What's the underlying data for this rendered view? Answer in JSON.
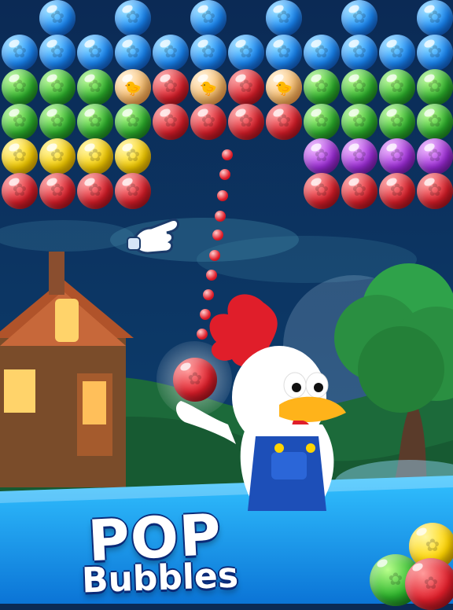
{
  "title": {
    "line1": "POP",
    "line2": "Bubbles"
  },
  "colors": {
    "sky_top": "#0b2a55",
    "sky_mid": "#0c3b6a",
    "ground": "#1c6a3a",
    "hud_blue": "#1fa7ff",
    "title_outline": "#0a2a78"
  },
  "icons": {
    "cursor": "pointing-hand-icon",
    "shooter": "red-bubble-shooter-icon",
    "character": "rooster-icon",
    "house": "house-icon",
    "tree": "tree-icon",
    "ui_bubbles": "corner-bubbles-icon"
  },
  "bubbles": [
    {
      "row": 0,
      "color": "blue",
      "cols": [
        1,
        3,
        5,
        7,
        9,
        11
      ]
    },
    {
      "row": 1,
      "color": "blue",
      "cols": [
        0,
        1,
        2,
        3,
        4,
        5,
        6,
        7,
        8,
        9,
        10,
        11
      ]
    },
    {
      "row": 2,
      "color": "mixed",
      "cols": [
        {
          "c": 0,
          "k": "green"
        },
        {
          "c": 1,
          "k": "green"
        },
        {
          "c": 2,
          "k": "green"
        },
        {
          "c": 3,
          "k": "chick"
        },
        {
          "c": 4,
          "k": "red"
        },
        {
          "c": 5,
          "k": "chick"
        },
        {
          "c": 6,
          "k": "red"
        },
        {
          "c": 7,
          "k": "chick"
        },
        {
          "c": 8,
          "k": "green"
        },
        {
          "c": 9,
          "k": "green"
        },
        {
          "c": 10,
          "k": "green"
        },
        {
          "c": 11,
          "k": "green"
        }
      ]
    },
    {
      "row": 3,
      "color": "mixed",
      "cols": [
        {
          "c": 0,
          "k": "green"
        },
        {
          "c": 1,
          "k": "green"
        },
        {
          "c": 2,
          "k": "green"
        },
        {
          "c": 3,
          "k": "green"
        },
        {
          "c": 4,
          "k": "red"
        },
        {
          "c": 5,
          "k": "red"
        },
        {
          "c": 6,
          "k": "red"
        },
        {
          "c": 7,
          "k": "red"
        },
        {
          "c": 8,
          "k": "green"
        },
        {
          "c": 9,
          "k": "green"
        },
        {
          "c": 10,
          "k": "green"
        },
        {
          "c": 11,
          "k": "green"
        }
      ]
    },
    {
      "row": 4,
      "color": "mixed",
      "cols": [
        {
          "c": 0,
          "k": "yellow"
        },
        {
          "c": 1,
          "k": "yellow"
        },
        {
          "c": 2,
          "k": "yellow"
        },
        {
          "c": 3,
          "k": "yellow"
        },
        {
          "c": 8,
          "k": "purple"
        },
        {
          "c": 9,
          "k": "purple"
        },
        {
          "c": 10,
          "k": "purple"
        },
        {
          "c": 11,
          "k": "purple"
        }
      ]
    },
    {
      "row": 5,
      "color": "mixed",
      "cols": [
        {
          "c": 0,
          "k": "red"
        },
        {
          "c": 1,
          "k": "red"
        },
        {
          "c": 2,
          "k": "red"
        },
        {
          "c": 3,
          "k": "red"
        },
        {
          "c": 8,
          "k": "red"
        },
        {
          "c": 9,
          "k": "red"
        },
        {
          "c": 10,
          "k": "red"
        },
        {
          "c": 11,
          "k": "red"
        }
      ]
    }
  ]
}
